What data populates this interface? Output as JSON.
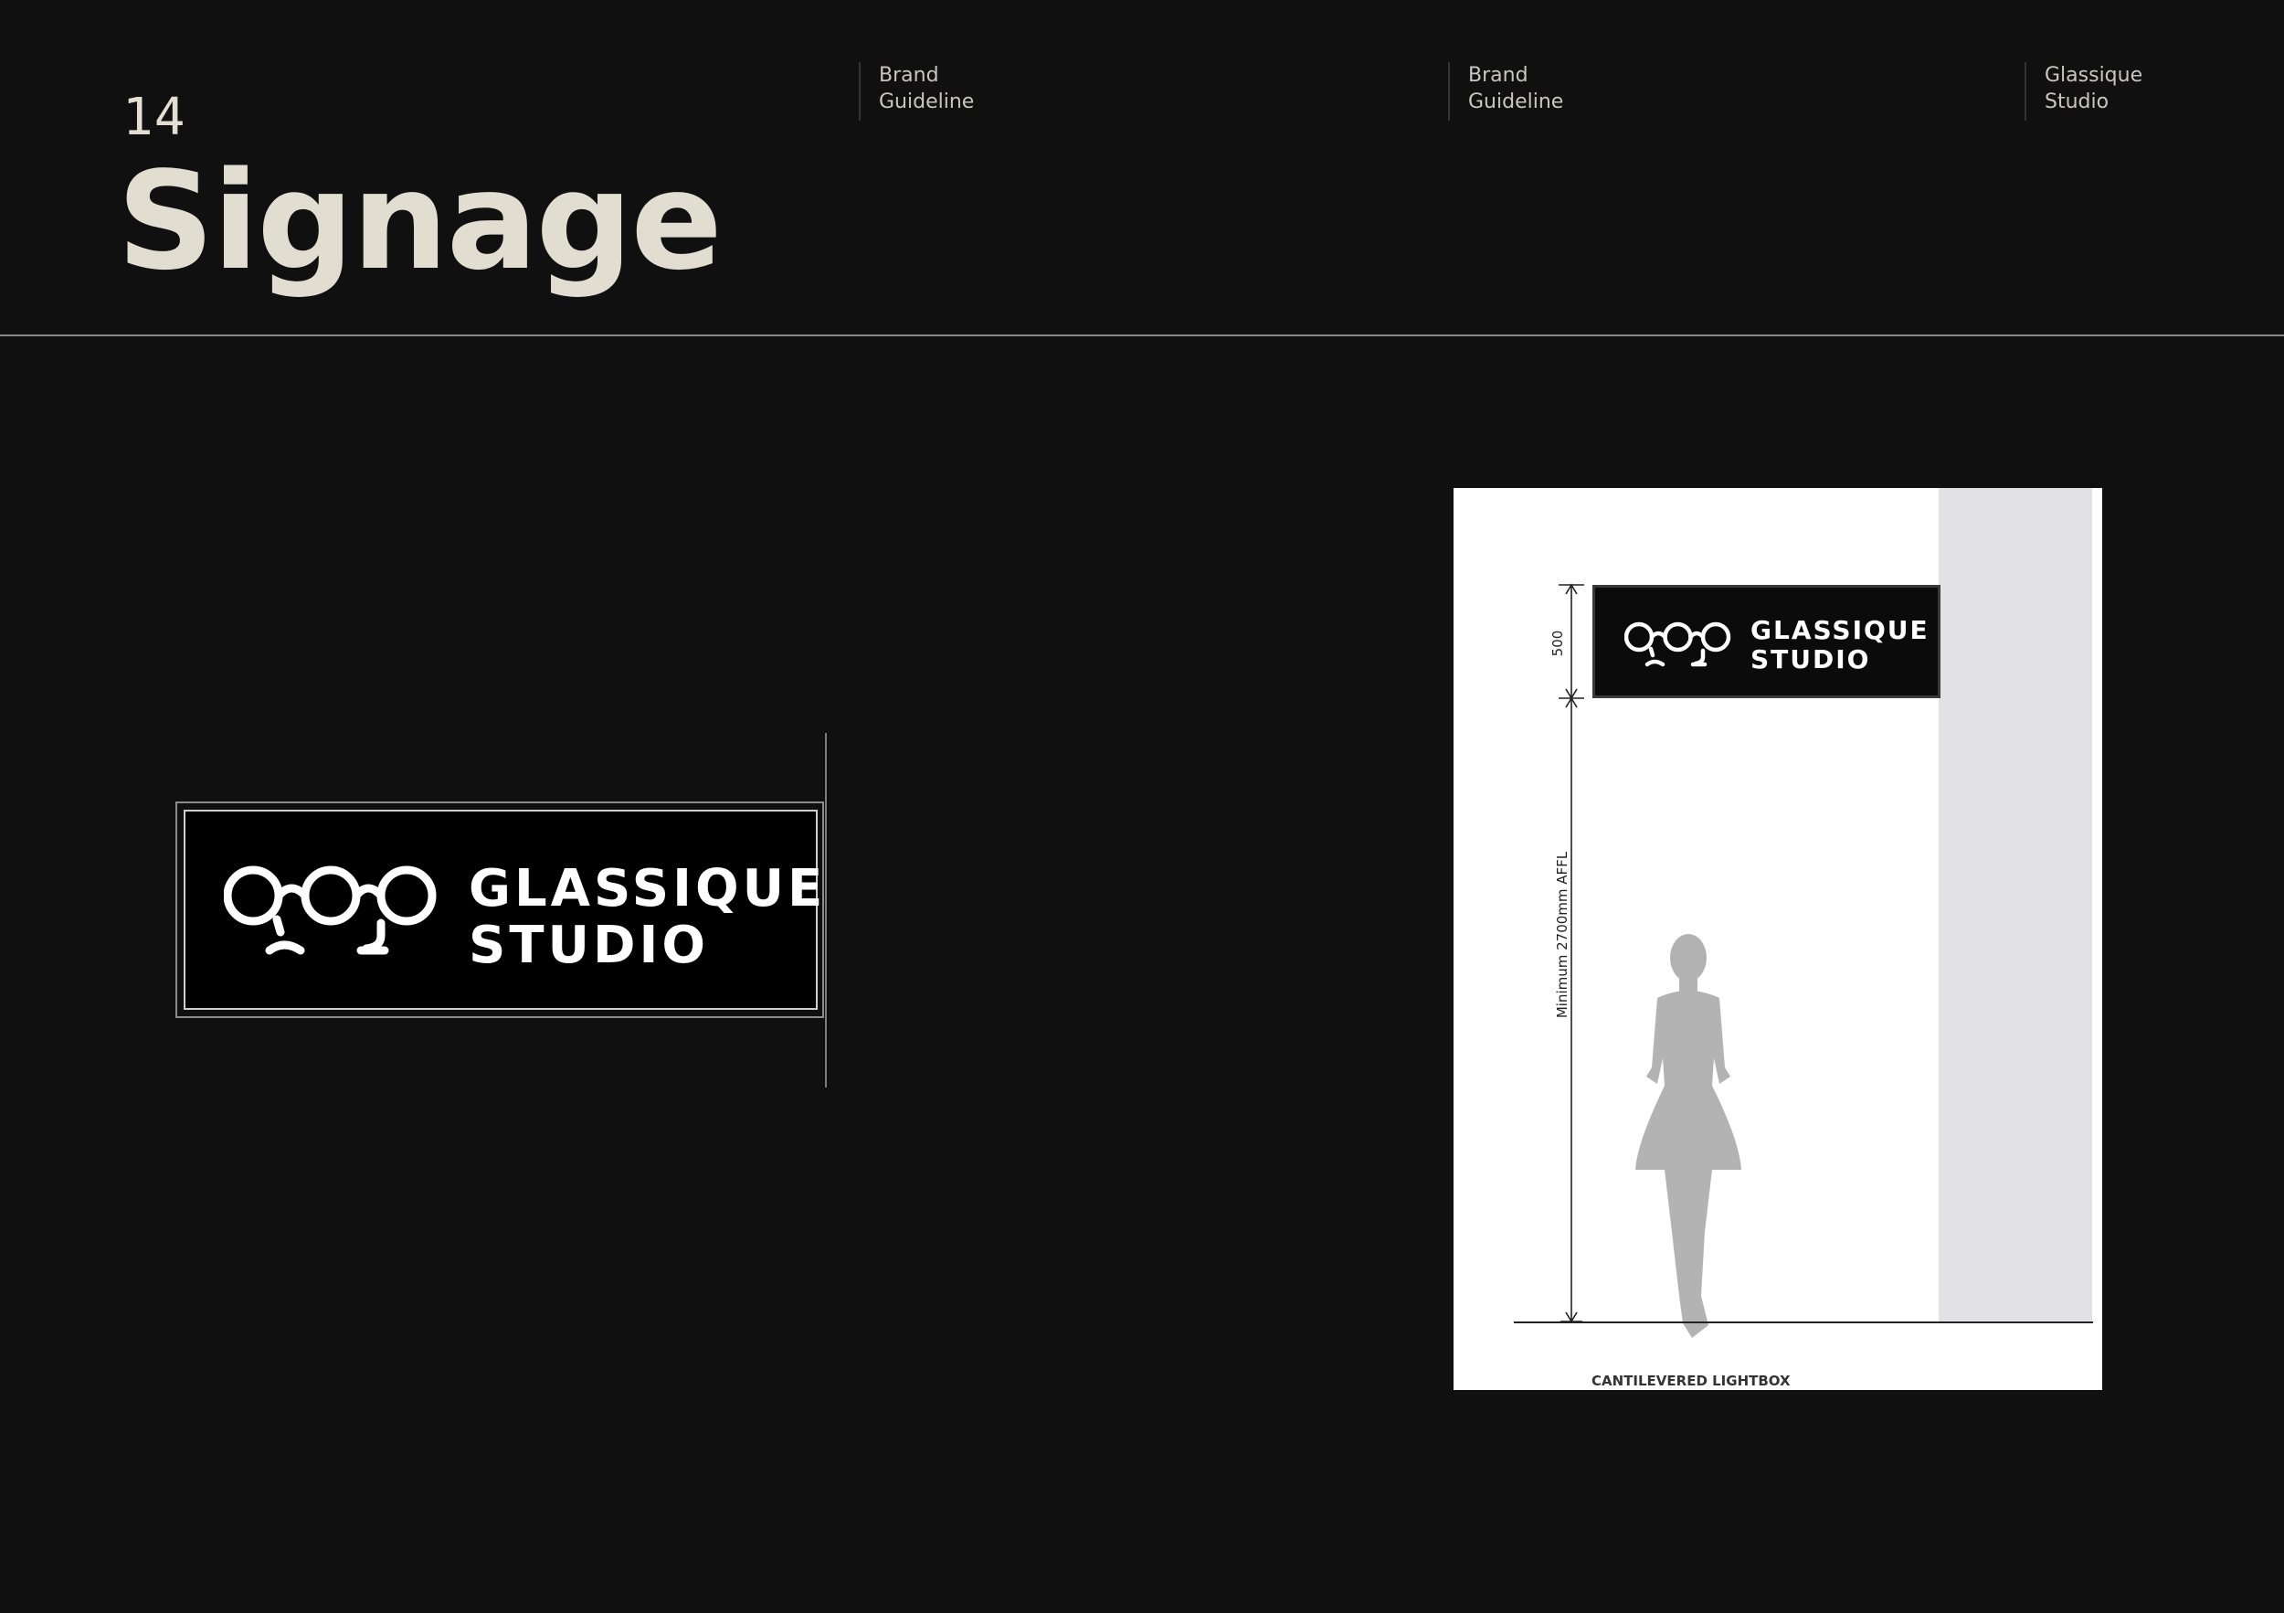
{
  "page": {
    "number": "14",
    "title": "Signage"
  },
  "header": {
    "columns": [
      {
        "line1": "Brand",
        "line2": "Guideline"
      },
      {
        "line1": "Brand",
        "line2": "Guideline"
      },
      {
        "line1": "Glassique",
        "line2": "Studio"
      }
    ]
  },
  "sign": {
    "line1": "GLASSIQUE",
    "line2": "STUDIO"
  },
  "drawing": {
    "sign_line1": "GLASSIQUE",
    "sign_line2": "STUDIO",
    "dim_sign_height": "500",
    "dim_clearance": "Minimum 2700mm AFFL",
    "caption": "CANTILEVERED LIGHTBOX"
  },
  "colors": {
    "background": "#101010",
    "title": "#e2ddd1",
    "sign_bg": "#000000",
    "wall": "#e2e1e6",
    "silhouette": "#b3b3b3"
  }
}
